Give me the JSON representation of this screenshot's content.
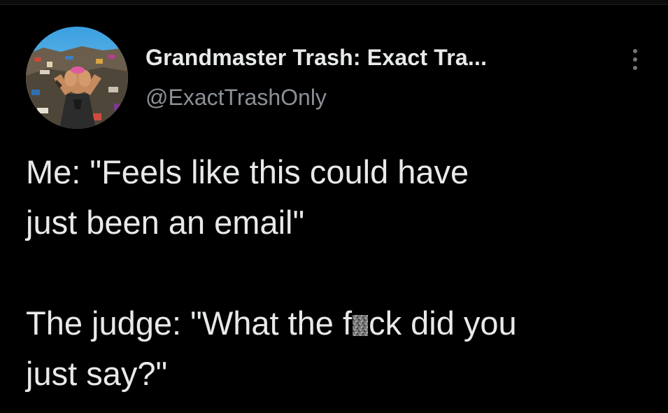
{
  "tweet": {
    "author": {
      "display_name": "Grandmaster Trash: Exact Tra...",
      "handle": "@ExactTrashOnly",
      "avatar_icon": "trash-heap-person-avatar"
    },
    "menu_icon": "more-vertical-icon",
    "body": {
      "line1_a": "Me: \"Feels like this could have",
      "line1_b": "just been an email\"",
      "line2_pre": "The judge: \"What the f",
      "line2_censored": "censored-letter",
      "line2_post": "ck did you",
      "line2_b": "just say?\""
    }
  },
  "colors": {
    "background": "#000000",
    "text_primary": "#e7e9ea",
    "text_secondary": "#8b9096",
    "menu_dots": "#71767b"
  }
}
